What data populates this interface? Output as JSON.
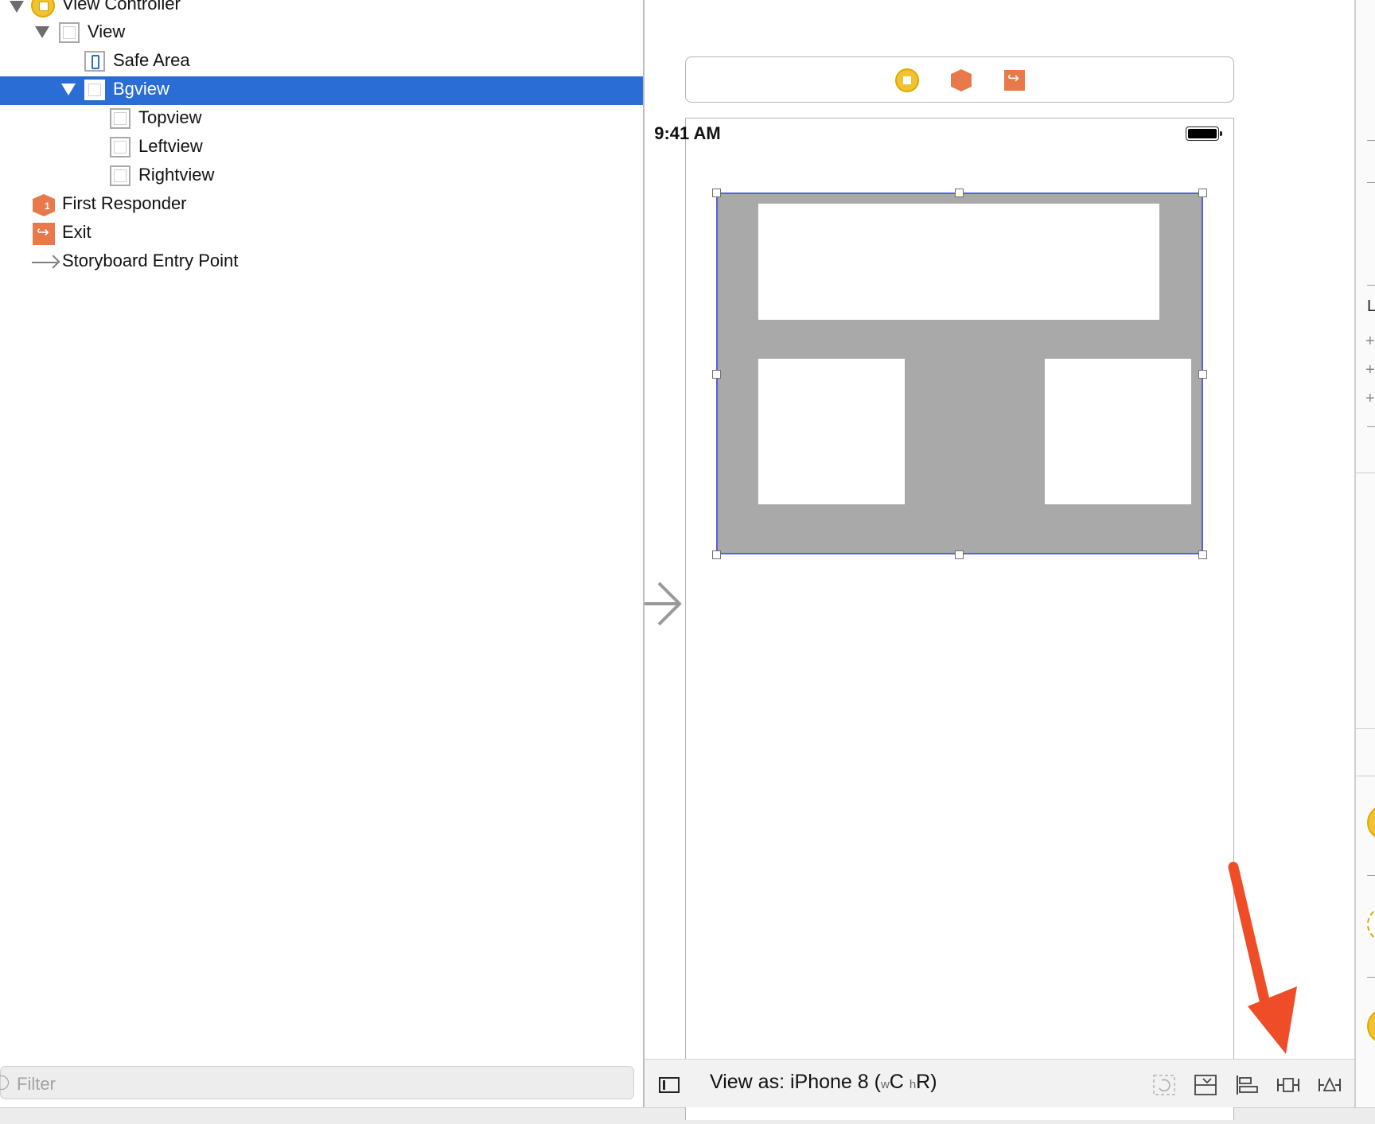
{
  "outline": {
    "items": [
      {
        "label": "View Controller"
      },
      {
        "label": "View"
      },
      {
        "label": "Safe Area"
      },
      {
        "label": "Bgview"
      },
      {
        "label": "Topview"
      },
      {
        "label": "Leftview"
      },
      {
        "label": "Rightview"
      },
      {
        "label": "First Responder"
      },
      {
        "label": "Exit"
      },
      {
        "label": "Storyboard Entry Point"
      }
    ],
    "selected": "Bgview"
  },
  "filter": {
    "placeholder": "Filter"
  },
  "canvas": {
    "status_time": "9:41 AM",
    "views": [
      "Bgview",
      "Topview",
      "Leftview",
      "Rightview"
    ]
  },
  "bottom_bar": {
    "view_as_prefix": "View as: iPhone 8 (",
    "w_label": "w",
    "w_class": "C",
    "h_label": "h",
    "h_class": "R",
    "close_paren": ")",
    "tools": [
      "update-frames-icon",
      "embed-in-stack-icon",
      "align-icon",
      "add-constraints-icon",
      "resolve-issues-icon"
    ]
  },
  "colors": {
    "selection": "#2a6ed5",
    "bgview_fill": "#a9a9a9",
    "selection_outline": "#5561d4",
    "annotation": "#ee4d27",
    "object_icon_orange": "#e8794b",
    "view_controller_yellow": "#f1c232"
  }
}
